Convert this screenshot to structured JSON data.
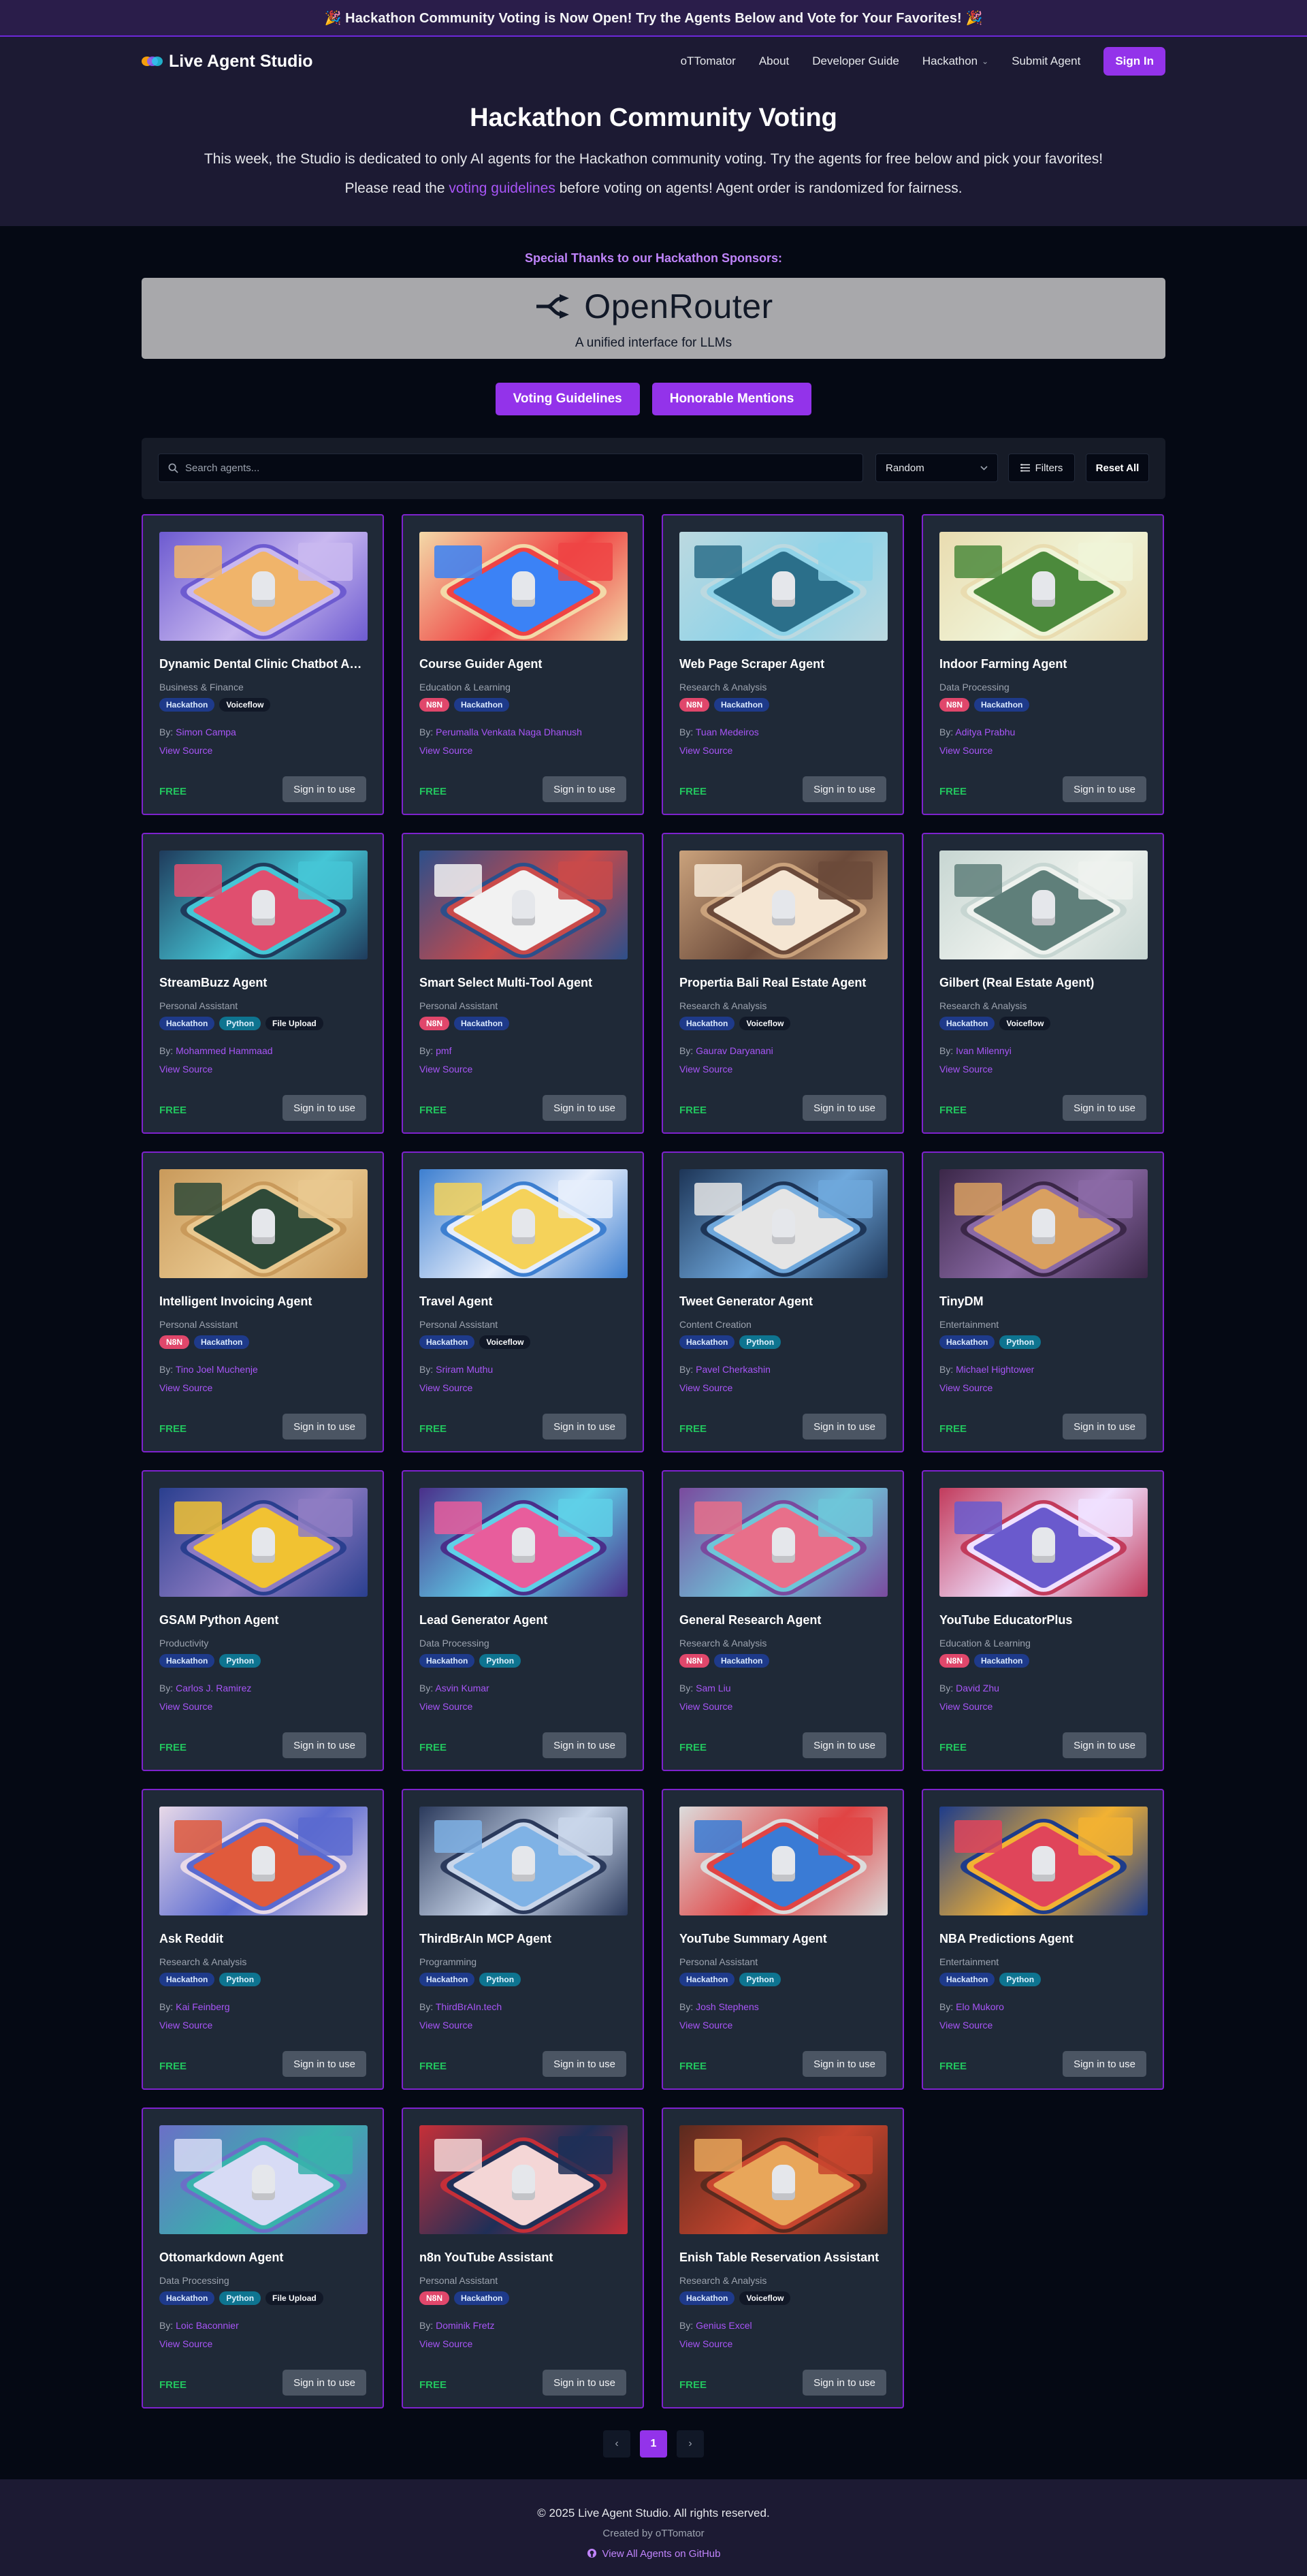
{
  "banner": {
    "text": "🎉 Hackathon Community Voting is Now Open! Try the Agents Below and Vote for Your Favorites! 🎉"
  },
  "nav": {
    "brand": "Live Agent Studio",
    "links": [
      "oTTomator",
      "About",
      "Developer Guide",
      "Hackathon",
      "Submit Agent"
    ],
    "signin": "Sign In"
  },
  "hero": {
    "title": "Hackathon Community Voting",
    "subtitle": "This week, the Studio is dedicated to only AI agents for the Hackathon community voting. Try the agents for free below and pick your favorites!",
    "note_before": "Please read the",
    "note_link": "voting guidelines",
    "note_after": "before voting on agents! Agent order is randomized for fairness."
  },
  "sponsors": {
    "title": "Special Thanks to our Hackathon Sponsors:",
    "name": "OpenRouter",
    "tagline": "A unified interface for LLMs"
  },
  "actions": {
    "guidelines": "Voting Guidelines",
    "mentions": "Honorable Mentions"
  },
  "filters": {
    "search_placeholder": "Search agents...",
    "sort_value": "Random",
    "filters_label": "Filters",
    "reset_label": "Reset All"
  },
  "card_common": {
    "price": "FREE",
    "use": "Sign in to use",
    "source": "View Source",
    "by": "By:"
  },
  "agents": [
    {
      "title": "Dynamic Dental Clinic Chatbot Agent",
      "category": "Business & Finance",
      "tags": [
        "Hackathon",
        "Voiceflow"
      ],
      "author": "Simon Campa",
      "palette": [
        "#6d5bd0",
        "#f0b46a",
        "#c9b8f0"
      ]
    },
    {
      "title": "Course Guider Agent",
      "category": "Education & Learning",
      "tags": [
        "N8N",
        "Hackathon"
      ],
      "author": "Perumalla Venkata Naga Dhanush",
      "palette": [
        "#f3d9a8",
        "#3b82f6",
        "#ef4444"
      ]
    },
    {
      "title": "Web Page Scraper Agent",
      "category": "Research & Analysis",
      "tags": [
        "N8N",
        "Hackathon"
      ],
      "author": "Tuan Medeiros",
      "palette": [
        "#bcd9e0",
        "#2b6f8a",
        "#8fd3e8"
      ]
    },
    {
      "title": "Indoor Farming Agent",
      "category": "Data Processing",
      "tags": [
        "N8N",
        "Hackathon"
      ],
      "author": "Aditya Prabhu",
      "palette": [
        "#e9dcb0",
        "#4c8a3c",
        "#f0f4d8"
      ]
    },
    {
      "title": "StreamBuzz Agent",
      "category": "Personal Assistant",
      "tags": [
        "Hackathon",
        "Python",
        "File Upload"
      ],
      "author": "Mohammed Hammaad",
      "palette": [
        "#1f3b5c",
        "#e04f6f",
        "#45c6d6"
      ]
    },
    {
      "title": "Smart Select Multi-Tool Agent",
      "category": "Personal Assistant",
      "tags": [
        "N8N",
        "Hackathon"
      ],
      "author": "pmf",
      "palette": [
        "#2d4f8a",
        "#f2f2f2",
        "#c94a4a"
      ]
    },
    {
      "title": "Propertia Bali Real Estate Agent",
      "category": "Research & Analysis",
      "tags": [
        "Hackathon",
        "Voiceflow"
      ],
      "author": "Gaurav Daryanani",
      "palette": [
        "#caa27c",
        "#f5e6d3",
        "#6b4a3a"
      ]
    },
    {
      "title": "Gilbert (Real Estate Agent)",
      "category": "Research & Analysis",
      "tags": [
        "Hackathon",
        "Voiceflow"
      ],
      "author": "Ivan Milennyi",
      "palette": [
        "#c7d6d2",
        "#5f7f7a",
        "#eef2ee"
      ]
    },
    {
      "title": "Intelligent Invoicing Agent",
      "category": "Personal Assistant",
      "tags": [
        "N8N",
        "Hackathon"
      ],
      "author": "Tino Joel Muchenje",
      "palette": [
        "#c99a5b",
        "#2f4a38",
        "#e9c88f"
      ]
    },
    {
      "title": "Travel Agent",
      "category": "Personal Assistant",
      "tags": [
        "Hackathon",
        "Voiceflow"
      ],
      "author": "Sriram Muthu",
      "palette": [
        "#3d7fd0",
        "#f5d25a",
        "#e6eefc"
      ]
    },
    {
      "title": "Tweet Generator Agent",
      "category": "Content Creation",
      "tags": [
        "Hackathon",
        "Python"
      ],
      "author": "Pavel Cherkashin",
      "palette": [
        "#1d3557",
        "#e5e5e5",
        "#6fa8dc"
      ]
    },
    {
      "title": "TinyDM",
      "category": "Entertainment",
      "tags": [
        "Hackathon",
        "Python"
      ],
      "author": "Michael Hightower",
      "palette": [
        "#3b2748",
        "#d9a060",
        "#8b6aa6"
      ]
    },
    {
      "title": "GSAM Python Agent",
      "category": "Productivity",
      "tags": [
        "Hackathon",
        "Python"
      ],
      "author": "Carlos J. Ramirez",
      "palette": [
        "#2a3f8f",
        "#f1c232",
        "#8e7cc3"
      ]
    },
    {
      "title": "Lead Generator Agent",
      "category": "Data Processing",
      "tags": [
        "Hackathon",
        "Python"
      ],
      "author": "Asvin Kumar",
      "palette": [
        "#4a2f8a",
        "#e85d9c",
        "#5fd0e8"
      ]
    },
    {
      "title": "General Research Agent",
      "category": "Research & Analysis",
      "tags": [
        "N8N",
        "Hackathon"
      ],
      "author": "Sam Liu",
      "palette": [
        "#7a4a9e",
        "#e86f8a",
        "#6ec6d9"
      ]
    },
    {
      "title": "YouTube EducatorPlus",
      "category": "Education & Learning",
      "tags": [
        "N8N",
        "Hackathon"
      ],
      "author": "David Zhu",
      "palette": [
        "#c23b5c",
        "#6a5acd",
        "#f0e1ff"
      ]
    },
    {
      "title": "Ask Reddit",
      "category": "Research & Analysis",
      "tags": [
        "Hackathon",
        "Python"
      ],
      "author": "Kai Feinberg",
      "palette": [
        "#e8d9e8",
        "#e05a3c",
        "#5a6ad0"
      ]
    },
    {
      "title": "ThirdBrAIn MCP Agent",
      "category": "Programming",
      "tags": [
        "Hackathon",
        "Python"
      ],
      "author": "ThirdBrAIn.tech",
      "palette": [
        "#2b3a5c",
        "#7fb2e5",
        "#c9d6ea"
      ]
    },
    {
      "title": "YouTube Summary Agent",
      "category": "Personal Assistant",
      "tags": [
        "Hackathon",
        "Python"
      ],
      "author": "Josh Stephens",
      "palette": [
        "#dcdcdc",
        "#3a7bd5",
        "#e04444"
      ]
    },
    {
      "title": "NBA Predictions Agent",
      "category": "Entertainment",
      "tags": [
        "Hackathon",
        "Python"
      ],
      "author": "Elo Mukoro",
      "palette": [
        "#1e3c8a",
        "#e0455a",
        "#f2b233"
      ]
    },
    {
      "title": "Ottomarkdown Agent",
      "category": "Data Processing",
      "tags": [
        "Hackathon",
        "Python",
        "File Upload"
      ],
      "author": "Loic Baconnier",
      "palette": [
        "#6b6fc7",
        "#d7dbf5",
        "#38b2ac"
      ]
    },
    {
      "title": "n8n YouTube Assistant",
      "category": "Personal Assistant",
      "tags": [
        "N8N",
        "Hackathon"
      ],
      "author": "Dominik Fretz",
      "palette": [
        "#c62f38",
        "#f4d6d6",
        "#1f2f57"
      ]
    },
    {
      "title": "Enish Table Reservation Assistant",
      "category": "Research & Analysis",
      "tags": [
        "Hackathon",
        "Voiceflow"
      ],
      "author": "Genius Excel",
      "palette": [
        "#5a2a1e",
        "#e8a65a",
        "#c8452e"
      ]
    }
  ],
  "pagination": {
    "prev": "‹",
    "current": "1",
    "next": "›"
  },
  "footer": {
    "copyright": "© 2025 Live Agent Studio. All rights reserved.",
    "created": "Created by oTTomator",
    "github": "View All Agents on GitHub"
  }
}
